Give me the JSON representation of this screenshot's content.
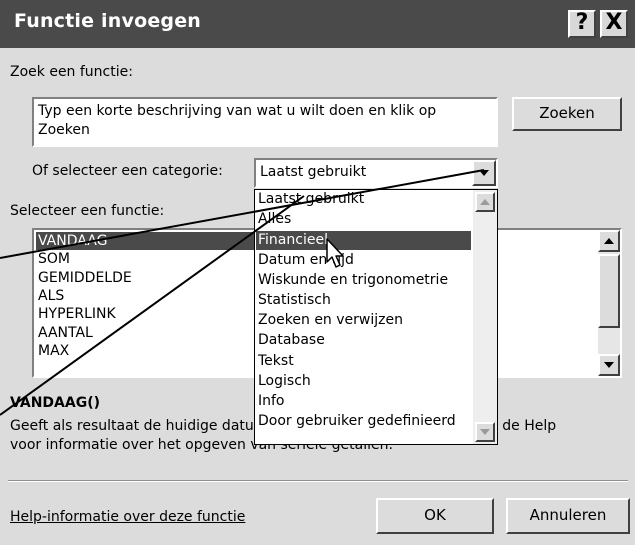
{
  "window": {
    "title": "Functie invoegen",
    "help_glyph": "?",
    "close_glyph": "X"
  },
  "search": {
    "label": "Zoek een functie:",
    "value": "Typ een korte beschrijving van wat u wilt doen en klik op Zoeken",
    "button": "Zoeken"
  },
  "category": {
    "label": "Of selecteer een categorie:",
    "selected": "Laatst gebruikt",
    "options": [
      "Laatst gebruikt",
      "Alles",
      "Financieel",
      "Datum en tijd",
      "Wiskunde en trigonometrie",
      "Statistisch",
      "Zoeken en verwijzen",
      "Database",
      "Tekst",
      "Logisch",
      "Info",
      "Door gebruiker gedefinieerd"
    ],
    "highlighted_option": "Financieel"
  },
  "functions": {
    "label": "Selecteer een functie:",
    "items": [
      "VANDAAG",
      "SOM",
      "GEMIDDELDE",
      "ALS",
      "HYPERLINK",
      "AANTAL",
      "MAX"
    ],
    "selected": "VANDAAG"
  },
  "description": {
    "signature": "VANDAAG()",
    "text_line1": "Geeft als resultaat de huidige datum in een datumnotatie. Raadpleeg de Help",
    "text_line2": "voor informatie over het opgeven van seriële getallen."
  },
  "footer": {
    "help_link": "Help-informatie over deze functie",
    "ok": "OK",
    "cancel": "Annuleren"
  }
}
